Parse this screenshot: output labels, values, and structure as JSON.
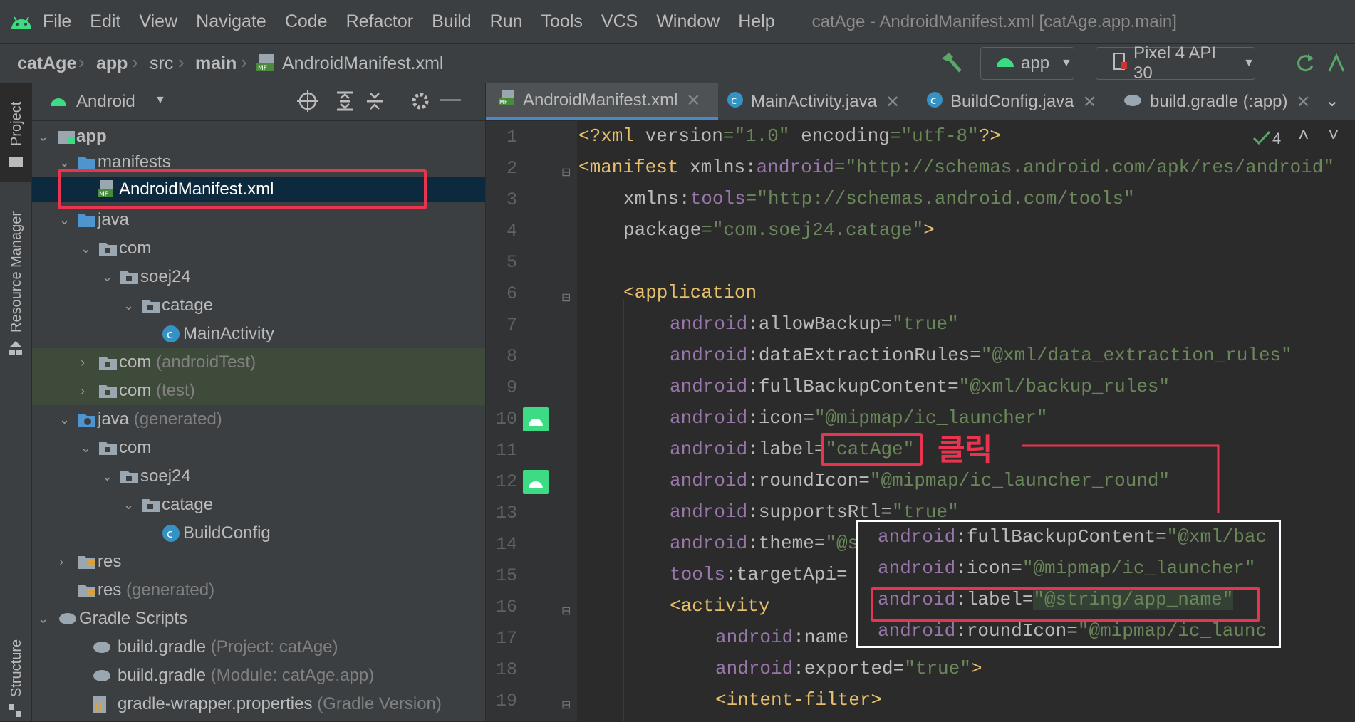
{
  "menubar": {
    "items": [
      "File",
      "Edit",
      "View",
      "Navigate",
      "Code",
      "Refactor",
      "Build",
      "Run",
      "Tools",
      "VCS",
      "Window",
      "Help"
    ],
    "title": "catAge - AndroidManifest.xml [catAge.app.main]"
  },
  "navbar": {
    "crumbs": [
      "catAge",
      "app",
      "src",
      "main",
      "AndroidManifest.xml"
    ],
    "run_config": "app",
    "device": "Pixel 4 API 30"
  },
  "stripe": {
    "project": "Project",
    "resource_manager": "Resource Manager",
    "structure": "Structure"
  },
  "project_panel": {
    "view_mode": "Android",
    "tree": [
      {
        "label": "app",
        "note": ""
      },
      {
        "label": "manifests",
        "note": ""
      },
      {
        "label": "AndroidManifest.xml",
        "note": ""
      },
      {
        "label": "java",
        "note": ""
      },
      {
        "label": "com",
        "note": ""
      },
      {
        "label": "soej24",
        "note": ""
      },
      {
        "label": "catage",
        "note": ""
      },
      {
        "label": "MainActivity",
        "note": ""
      },
      {
        "label": "com",
        "note": "(androidTest)"
      },
      {
        "label": "com",
        "note": "(test)"
      },
      {
        "label": "java",
        "note": "(generated)"
      },
      {
        "label": "com",
        "note": ""
      },
      {
        "label": "soej24",
        "note": ""
      },
      {
        "label": "catage",
        "note": ""
      },
      {
        "label": "BuildConfig",
        "note": ""
      },
      {
        "label": "res",
        "note": ""
      },
      {
        "label": "res",
        "note": "(generated)"
      },
      {
        "label": "Gradle Scripts",
        "note": ""
      },
      {
        "label": "build.gradle",
        "note": "(Project: catAge)"
      },
      {
        "label": "build.gradle",
        "note": "(Module: catAge.app)"
      },
      {
        "label": "gradle-wrapper.properties",
        "note": "(Gradle Version)"
      }
    ]
  },
  "editor": {
    "tabs": [
      "AndroidManifest.xml",
      "MainActivity.java",
      "BuildConfig.java",
      "build.gradle (:app)"
    ],
    "inspection_count": "4",
    "line_numbers": [
      "1",
      "2",
      "3",
      "4",
      "5",
      "6",
      "7",
      "8",
      "9",
      "10",
      "11",
      "12",
      "13",
      "14",
      "15",
      "16",
      "17",
      "18",
      "19"
    ],
    "annotation": "클릭",
    "popup_lines": [
      {
        "ns": "android",
        "attr": ":fullBackupContent=",
        "val": "\"@xml/bac"
      },
      {
        "ns": "android",
        "attr": ":icon=",
        "val": "\"@mipmap/ic_launcher\""
      },
      {
        "ns": "android",
        "attr": ":label=",
        "val": "\"@string/app_name\""
      },
      {
        "ns": "android",
        "attr": ":roundIcon=",
        "val": "\"@mipmap/ic_launc"
      }
    ]
  },
  "colors": {
    "highlight": "#e8344e",
    "selection": "#0d293e"
  }
}
